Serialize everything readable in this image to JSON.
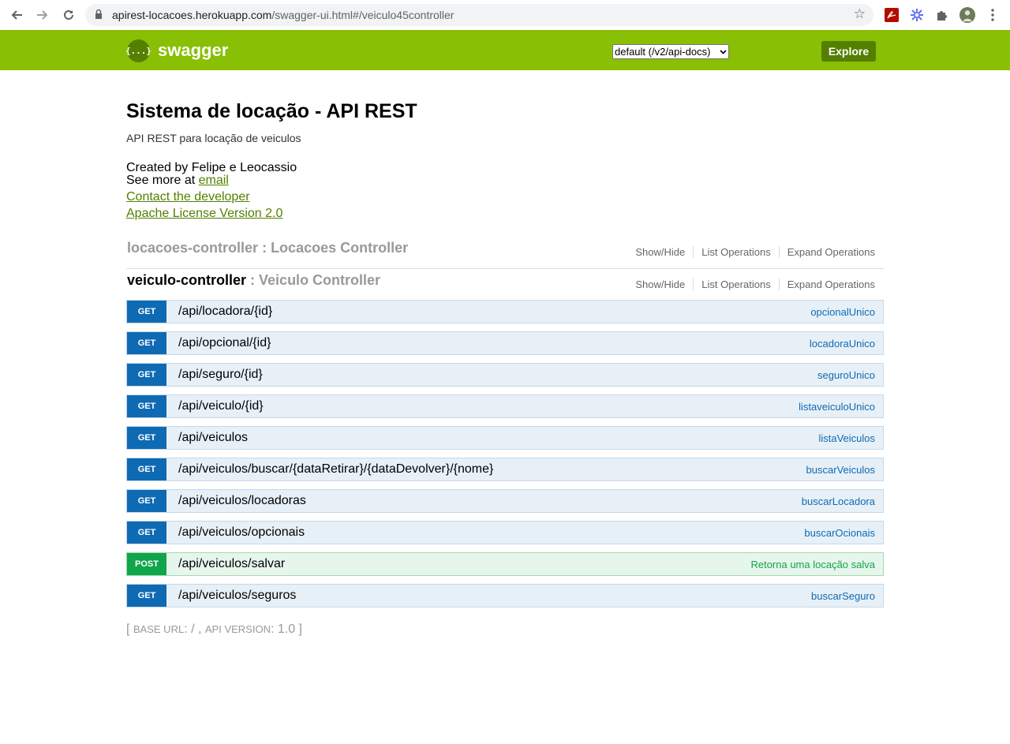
{
  "browser": {
    "url_host": "apirest-locacoes.herokuapp.com",
    "url_path": "/swagger-ui.html#/veiculo45controller",
    "icons": [
      "back-arrow-icon",
      "forward-arrow-icon",
      "reload-icon",
      "lock-icon",
      "star-icon",
      "pdf-extension-icon",
      "flower-extension-icon",
      "puzzle-extension-icon",
      "profile-avatar",
      "kebab-menu-icon"
    ]
  },
  "header": {
    "logo_glyph": "{...}",
    "logo_text": "swagger",
    "api_select": "default (/v2/api-docs)",
    "explore_label": "Explore",
    "bg_color": "#89bf04"
  },
  "info": {
    "title": "Sistema de locação - API REST",
    "description": "API REST para locação de veiculos",
    "created_by": "Created by Felipe e Leocassio",
    "see_more_prefix": "See more at ",
    "see_more_link": "email",
    "contact_link": "Contact the developer",
    "license_link": "Apache License Version 2.0"
  },
  "resources": [
    {
      "name": "locacoes-controller",
      "separator": " : ",
      "description": "Locacoes Controller",
      "actions": [
        "Show/Hide",
        "List Operations",
        "Expand Operations"
      ]
    },
    {
      "name": "veiculo-controller",
      "separator": " : ",
      "description": "Veiculo Controller",
      "actions": [
        "Show/Hide",
        "List Operations",
        "Expand Operations"
      ]
    }
  ],
  "operations": [
    {
      "method": "GET",
      "path": "/api/locadora/{id}",
      "summary": "opcionalUnico"
    },
    {
      "method": "GET",
      "path": "/api/opcional/{id}",
      "summary": "locadoraUnico"
    },
    {
      "method": "GET",
      "path": "/api/seguro/{id}",
      "summary": "seguroUnico"
    },
    {
      "method": "GET",
      "path": "/api/veiculo/{id}",
      "summary": "listaveiculoUnico"
    },
    {
      "method": "GET",
      "path": "/api/veiculos",
      "summary": "listaVeiculos"
    },
    {
      "method": "GET",
      "path": "/api/veiculos/buscar/{dataRetirar}/{dataDevolver}/{nome}",
      "summary": "buscarVeiculos"
    },
    {
      "method": "GET",
      "path": "/api/veiculos/locadoras",
      "summary": "buscarLocadora"
    },
    {
      "method": "GET",
      "path": "/api/veiculos/opcionais",
      "summary": "buscarOcionais"
    },
    {
      "method": "POST",
      "path": "/api/veiculos/salvar",
      "summary": "Retorna uma locação salva"
    },
    {
      "method": "GET",
      "path": "/api/veiculos/seguros",
      "summary": "buscarSeguro"
    }
  ],
  "footer": {
    "open": "[ ",
    "base_url_label": "BASE URL",
    "base_url_value": ": / , ",
    "api_version_label": "API VERSION",
    "api_version_value": ": 1.0 ]"
  },
  "colors": {
    "get": "#0f6ab4",
    "post": "#10a54a",
    "link": "#547f00"
  }
}
